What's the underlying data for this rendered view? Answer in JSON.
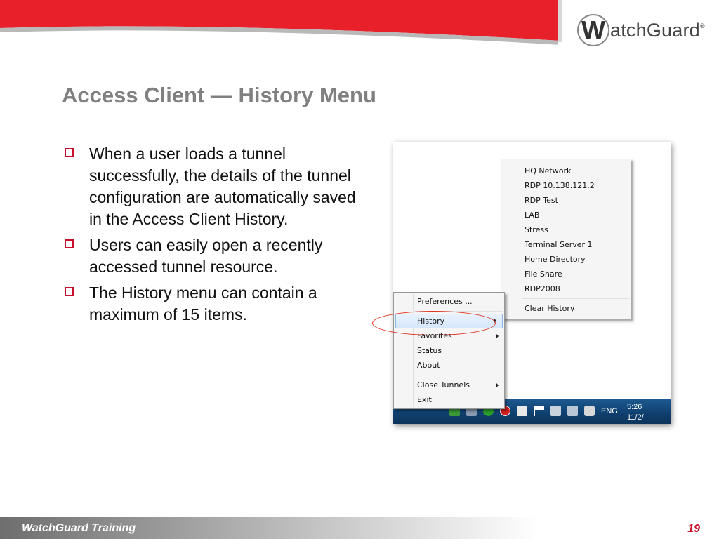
{
  "brand": {
    "logo_letter": "W",
    "logo_text": "atchGuard",
    "logo_mark": "®",
    "red": "#e8202a",
    "grey": "#808080"
  },
  "slide": {
    "title": "Access Client — History Menu",
    "bullets": [
      "When a user loads a tunnel successfully, the details of the tunnel configuration are automatically saved in the Access Client History.",
      "Users can easily open a recently accessed tunnel resource.",
      "The History menu can contain a maximum of 15 items."
    ]
  },
  "context_menu": {
    "items": [
      {
        "label": "Preferences ..."
      },
      {
        "label": "History",
        "highlighted": true,
        "submenu": true
      },
      {
        "label": "Favorites",
        "submenu": true
      },
      {
        "label": "Status"
      },
      {
        "label": "About"
      },
      {
        "label": "Close Tunnels",
        "submenu": true
      },
      {
        "label": "Exit"
      }
    ]
  },
  "history_menu": {
    "items": [
      "HQ Network",
      "RDP 10.138.121.2",
      "RDP Test",
      "LAB",
      "Stress",
      "Terminal Server 1",
      "Home Directory",
      "File Share",
      "RDP2008"
    ],
    "clear_label": "Clear History"
  },
  "taskbar": {
    "language": "ENG",
    "time": "5:26",
    "date": "11/2/",
    "tray_icons": [
      "app-icon",
      "network-icon",
      "chat-icon",
      "watchguard-icon",
      "notes-icon",
      "flag-icon",
      "power-icon",
      "monitor-icon",
      "volume-icon"
    ]
  },
  "footer": {
    "label": "WatchGuard Training",
    "page": "19"
  }
}
